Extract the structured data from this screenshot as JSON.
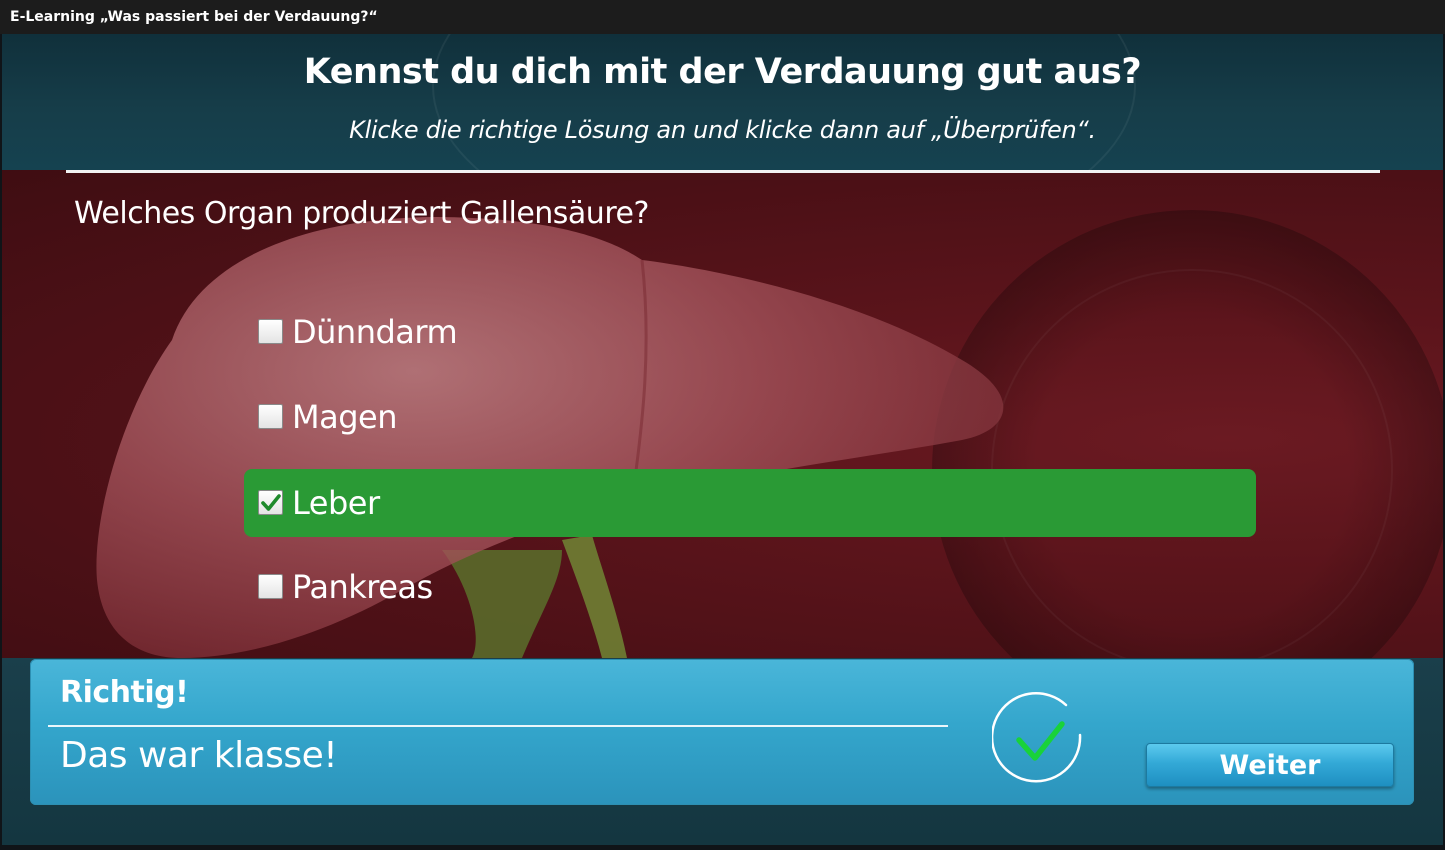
{
  "window": {
    "title": "E-Learning „Was passiert bei der Verdauung?“"
  },
  "header": {
    "heading": "Kennst du dich mit der Verdauung gut aus?",
    "instruction": "Klicke die richtige Lösung an und klicke dann auf „Überprüfen“."
  },
  "quiz": {
    "question": "Welches Organ produziert Gallensäure?",
    "options": [
      {
        "label": "Dünndarm",
        "checked": false
      },
      {
        "label": "Magen",
        "checked": false
      },
      {
        "label": "Leber",
        "checked": true
      },
      {
        "label": "Pankreas",
        "checked": false
      }
    ]
  },
  "feedback": {
    "title": "Richtig!",
    "message": "Das war klasse!",
    "icon": "checkmark-circle-icon",
    "button_label": "Weiter"
  },
  "colors": {
    "selected_option": "#2a9a35",
    "feedback_panel": "#34a6cc",
    "checkmark": "#19d23a"
  }
}
